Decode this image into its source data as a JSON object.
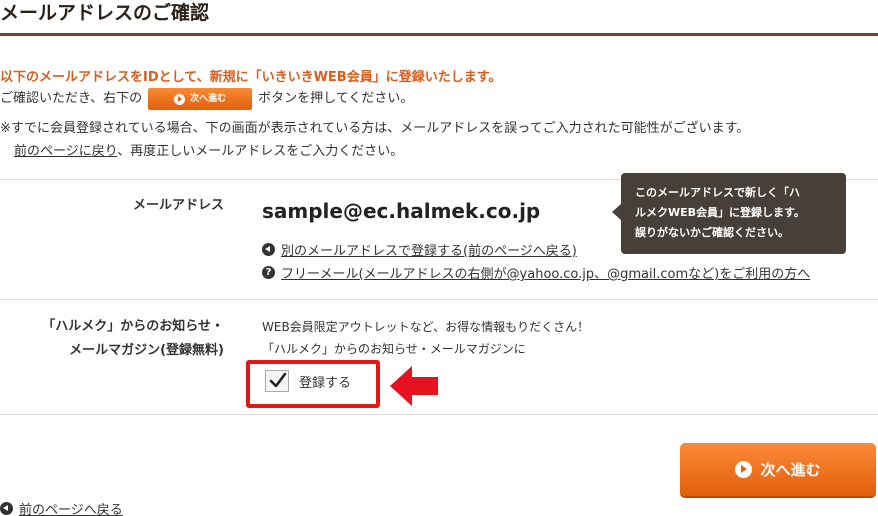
{
  "title": "メールアドレスのご確認",
  "lead": "以下のメールアドレスをIDとして、新規に「いきいきWEB会員」に登録いたします。",
  "instruction": {
    "before": "ご確認いただき、右下の",
    "button_label": "次へ進む",
    "after": "ボタンを押してください。"
  },
  "note": "※すでに会員登録されている場合、下の画面が表示されている方は、メールアドレスを誤ってご入力された可能性がございます。",
  "back_line": {
    "link": "前のページに戻り",
    "text": "、再度正しいメールアドレスをご入力ください。"
  },
  "email_row": {
    "label": "メールアドレス",
    "value": "sample@ec.halmek.co.jp",
    "other_email_link": "別のメールアドレスで登録する(前のページへ戻る)",
    "free_mail_link": "フリーメール(メールアドレスの右側が@yahoo.co.jp、@gmail.comなど)をご利用の方へ"
  },
  "tooltip": {
    "line1": "このメールアドレスで新しく「ハ",
    "line2": "ルメクWEB会員」に登録します。",
    "line3": "誤りがないかご確認ください。"
  },
  "newsletter_row": {
    "label_line1": "「ハルメク」からのお知らせ・",
    "label_line2": "メールマガジン(登録無料)",
    "desc_line1": "WEB会員限定アウトレットなど、お得な情報もりだくさん！",
    "desc_line2": "「ハルメク」からのお知らせ・メールマガジンに",
    "checkbox_label": "登録する",
    "checked": true
  },
  "next_button": "次へ進む",
  "bottom_back_link": "前のページへ戻る",
  "colors": {
    "accent": "#e35f0c",
    "lead_text": "#d95d1c",
    "highlight": "#e01818",
    "tooltip_bg": "#47403a",
    "title_rule": "#6b4a2f"
  }
}
